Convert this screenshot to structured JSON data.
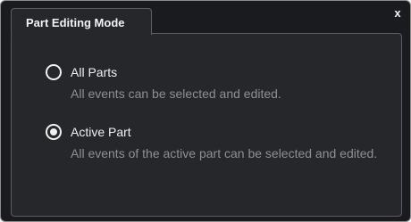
{
  "dialog": {
    "tab_label": "Part Editing Mode",
    "close_label": "x"
  },
  "options": [
    {
      "label": "All Parts",
      "description": "All events can be selected and edited.",
      "selected": false
    },
    {
      "label": "Active Part",
      "description": "All events of the active part can be selected and edited.",
      "selected": true
    }
  ]
}
